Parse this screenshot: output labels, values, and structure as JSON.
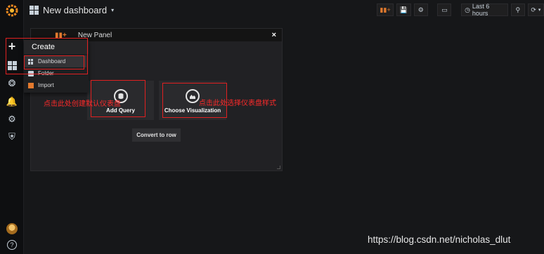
{
  "topbar": {
    "title": "New dashboard",
    "time_range": "Last 6 hours"
  },
  "panel": {
    "title": "New Panel",
    "add_query_label": "Add Query",
    "choose_viz_label": "Choose Visualization",
    "convert_label": "Convert to row",
    "close_glyph": "×"
  },
  "create_menu": {
    "header": "Create",
    "items": [
      {
        "label": "Dashboard",
        "icon": "dashboard-icon"
      },
      {
        "label": "Folder",
        "icon": "folder-icon"
      },
      {
        "label": "Import",
        "icon": "import-icon"
      }
    ]
  },
  "annotations": {
    "query_note": "点击此处创建默认仪表盘",
    "viz_note": "点击此处选择仪表盘样式"
  },
  "watermark": "https://blog.csdn.net/nicholas_dlut",
  "help_glyph": "?",
  "colors": {
    "accent": "#e27a2e",
    "annotation_red": "#e02020",
    "background": "#161719"
  }
}
